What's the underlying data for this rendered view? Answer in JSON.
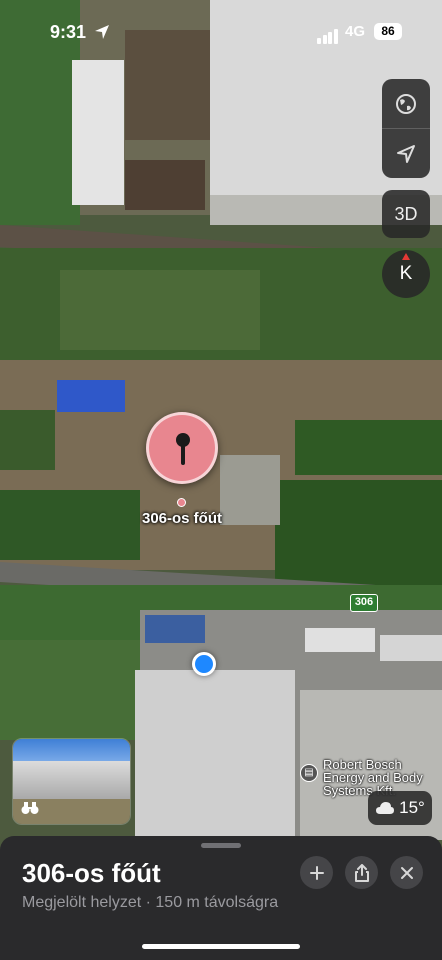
{
  "status_bar": {
    "time": "9:31",
    "network": "4G",
    "battery": "86"
  },
  "map": {
    "pin_label": "306-os főút",
    "road_number": "306",
    "poi_label": "Robert Bosch Energy and Body Systems Kft.",
    "compass_letter": "K",
    "view_3d_label": "3D",
    "weather": "15°",
    "map_mode_icon": "globe-icon",
    "tracking_icon": "location-arrow-icon"
  },
  "place_card": {
    "title": "306-os főút",
    "subtitle": "Megjelölt helyzet · 150 m távolságra",
    "actions": [
      "add-icon",
      "share-icon",
      "close-icon"
    ]
  },
  "colors": {
    "pin": "#e8868f",
    "user_location": "#1e88ff",
    "sheet_bg": "#2a2a2c",
    "route_sign": "#2e7d32"
  }
}
